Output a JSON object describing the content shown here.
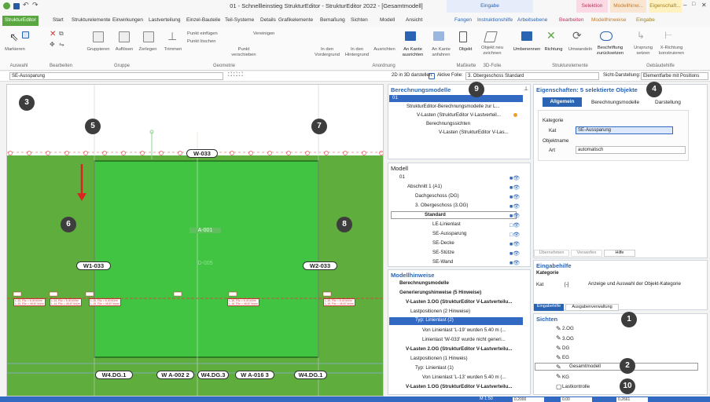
{
  "window": {
    "title": "01 - Schnellleinstieg StrukturEditor - StrukturEditor 2022 - [Gesamtmodell]",
    "ctx_tabs": [
      "Eingabe",
      "Selektion",
      "Modellhinw...",
      "Eigenschaft..."
    ]
  },
  "ribbon_tabs": [
    "StrukturEditor",
    "Start",
    "Strukturelemente",
    "Einwirkungen",
    "Lastverteilung",
    "Einzel-Bauteile",
    "Teil-Systeme",
    "Details",
    "Grafikelemente",
    "Bemaßung",
    "Sichten",
    "Modell",
    "Ansicht",
    "Fangen",
    "Instruktionshilfe",
    "Arbeitsebene",
    "Bearbeiten",
    "Modellhinweise",
    "Eingabe"
  ],
  "ribbon": {
    "groups": [
      "Auswahl",
      "Bearbeiten",
      "Gruppe",
      "Geometrie",
      "Anordnung",
      "Maßkette",
      "3D-Folie",
      "Strukturelemente",
      "Gebäudehilfe"
    ],
    "buttons": [
      "Markieren",
      "Gruppieren",
      "Auflösen",
      "Zerlegen",
      "Trimmen",
      "Punkt einfügen",
      "Punkt löschen",
      "Vereinigen",
      "Punkt verschieben",
      "In den Vordergrund",
      "In den Hintergrund",
      "Ausrichten",
      "An Kante ausrichten",
      "An Kante anfahren",
      "Objekt",
      "Objekt neu zeichnen",
      "Umbenennen",
      "Richtung",
      "Umwandeln",
      "Beschriftung zurücksetzen",
      "Ursprung setzen",
      "X-Richtung konstruieren"
    ]
  },
  "toolbar2": {
    "filter": "SE-Aussparung",
    "mode3d": "2D in 3D darstellen:",
    "active_folie_label": "Aktive Folie:",
    "active_folie": "3. Obergeschoss Standard",
    "sicht_label": "Sicht-Darstellung:",
    "sicht": "Elementfarbe mit Positions"
  },
  "canvas": {
    "labels": {
      "w033": "W-033",
      "a001": "A-001",
      "d005": "D-005",
      "w1": "W1-033",
      "w2": "W2-033",
      "b1": "W4.DG.1",
      "b2": "W A-002 2",
      "b3": "W4.DG.3",
      "b4": "W A-016 3",
      "b5": "W4.DG.1"
    }
  },
  "berechnung": {
    "title": "Berechnungsmodelle",
    "rows": [
      "01",
      "StrukturEditor-Berechnungsmodelle zur L...",
      "V-Lasten (StrukturEditor V-Lastverteil...",
      "Berechnungssichten",
      "V-Lasten (StrukturEditor V-Las..."
    ]
  },
  "modell": {
    "title": "Modell",
    "rows": [
      "01",
      "Abschnitt 1 (A1)",
      "Dachgeschoss (DG)",
      "3. Obergeschoss (3.OG)",
      "Standard",
      "LE-Linienlast",
      "SE-Aussparung",
      "SE-Decke",
      "SE-Stütze",
      "SE-Wand"
    ]
  },
  "hinweise": {
    "title": "Modellhinweise",
    "rows": [
      "Berechnungsmodelle",
      "Generierungshinweise (5 Hinweise)",
      "V-Lasten 3.OG (StrukturEditor V-Lastverteilu...",
      "Lastpositionen (2 Hinweise)",
      "Typ: Linienlast (2)",
      "Von Linienlast 'L-19' wurden 5.40 m (...",
      "Linienlast 'W-033' wurde nicht generi...",
      "V-Lasten 2.OG (StrukturEditor V-Lastverteilu...",
      "Lastpositionen (1 Hinweis)",
      "Typ: Linienlast (1)",
      "Von Linienlast 'L-13' wurden 5.40 m (...",
      "V-Lasten 1.OG (StrukturEditor V-Lastverteilu..."
    ]
  },
  "eigenschaften": {
    "title": "Eigenschaften: 5 selektierte Objekte",
    "tabs": [
      "Allgemein",
      "Berechnungsmodelle",
      "Darstellung"
    ],
    "kategorie": "Kategorie",
    "kat_label": "Kat",
    "kat_value": "SE-Aussparung",
    "objektname": "Objektname",
    "art_label": "Art",
    "art_value": "automatisch",
    "btns": [
      "Übernehmen",
      "Verwerfen",
      "Hilfe"
    ]
  },
  "eingabehilfe": {
    "title": "Eingabehilfe",
    "kategorie": "Kategorie",
    "kat": "Kat",
    "bracket": "[-]",
    "desc": "Anzeige und Auswahl der Objekt-Kategorie",
    "tabs": [
      "Eingabehilfe",
      "Ausgabenverwaltung"
    ]
  },
  "sichten": {
    "title": "Sichten",
    "rows": [
      "2.OG",
      "3.OG",
      "DG",
      "EG",
      "Gesamtmodell",
      "KG",
      "Lastkontrolle"
    ]
  },
  "badges": [
    "1",
    "2",
    "3",
    "4",
    "5",
    "6",
    "7",
    "8",
    "9",
    "10"
  ],
  "status": {
    "scale": "M 1:50",
    "x": "0.2000",
    "w": "0.00",
    "v": "0.2661"
  },
  "colors": {
    "accent": "#2a64b3",
    "ground": "#5fad3c",
    "slab": "#3fbf3f",
    "badge": "#3d3d3d",
    "arrow": "#d22"
  }
}
